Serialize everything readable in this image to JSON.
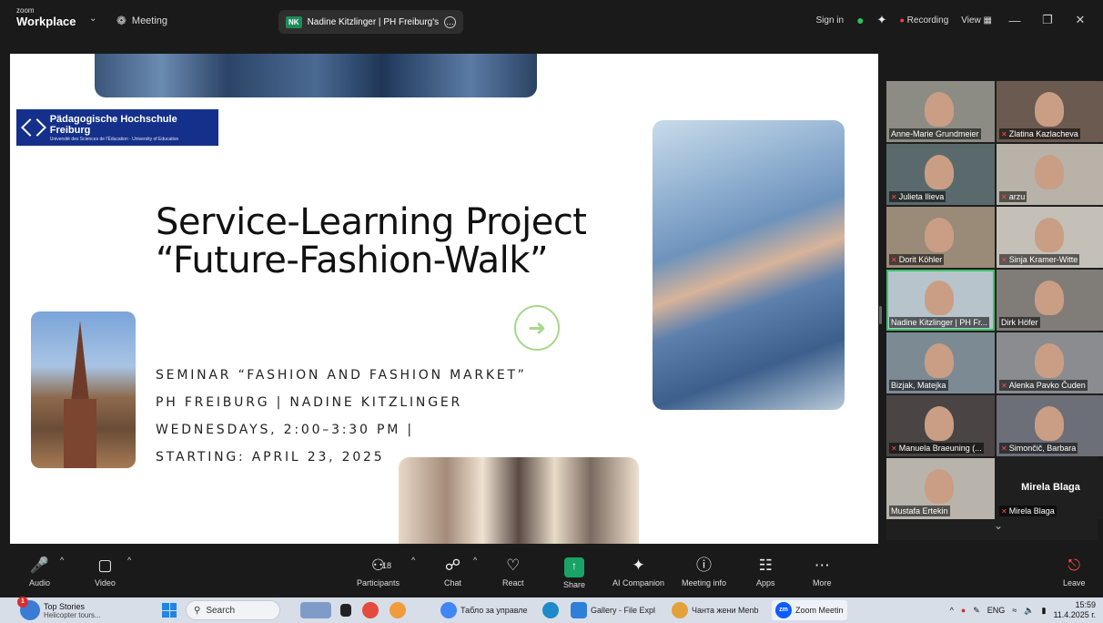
{
  "app": {
    "logo_small": "zoom",
    "logo_big": "Workplace",
    "meeting_label": "Meeting"
  },
  "share_banner": {
    "initials": "NK",
    "text": "Nadine Kitzlinger | PH Freiburg's"
  },
  "topbar_right": {
    "sign_in": "Sign in",
    "recording": "Recording",
    "view": "View"
  },
  "slide": {
    "logo_title": "Pädagogische Hochschule Freiburg",
    "logo_subtitle": "Université des Sciences de l'Éducation · University of Education",
    "title_line1": "Service-Learning Project",
    "title_line2": "“Future-Fashion-Walk”",
    "lines": [
      "SEMINAR “FASHION AND FASHION MARKET”",
      "PH FREIBURG | NADINE KITZLINGER",
      "WEDNESDAYS, 2:00–3:30 PM |",
      "STARTING: APRIL 23, 2025"
    ]
  },
  "gallery": [
    {
      "name": "Anne-Marie Grundmeier",
      "muted": false
    },
    {
      "name": "Zlatina Kazlacheva",
      "muted": true
    },
    {
      "name": "Julieta Ilieva",
      "muted": true
    },
    {
      "name": "arzu",
      "muted": true
    },
    {
      "name": "Dorit Köhler",
      "muted": true
    },
    {
      "name": "Sinja Kramer-Witte",
      "muted": true
    },
    {
      "name": "Nadine Kitzlinger | PH Fr...",
      "muted": false,
      "active": true
    },
    {
      "name": "Dirk Höfer",
      "muted": false
    },
    {
      "name": "Bizjak, Matejka",
      "muted": false
    },
    {
      "name": "Alenka Pavko Čuden",
      "muted": true
    },
    {
      "name": "Manuela Braeuning (...",
      "muted": true
    },
    {
      "name": "Simončič, Barbara",
      "muted": true
    },
    {
      "name": "Mustafa Ertekin",
      "muted": false
    },
    {
      "name": "Mirela Blaga",
      "muted": true,
      "big_label": "Mirela Blaga"
    }
  ],
  "toolbar": {
    "audio": "Audio",
    "video": "Video",
    "participants": "Participants",
    "participants_count": "18",
    "chat": "Chat",
    "react": "React",
    "share": "Share",
    "ai_companion": "AI Companion",
    "meeting_info": "Meeting info",
    "apps": "Apps",
    "more": "More",
    "leave": "Leave"
  },
  "taskbar": {
    "news_badge": "1",
    "news_title": "Top Stories",
    "news_sub": "Helicopter tours...",
    "search": "Search",
    "item1": "Табло за управле",
    "item2": "Gallery - File Expl",
    "item3": "Чанта жени Menb",
    "item4": "Zoom Meetin",
    "lang": "ENG",
    "time": "15:59",
    "date": "11.4.2025 г."
  }
}
